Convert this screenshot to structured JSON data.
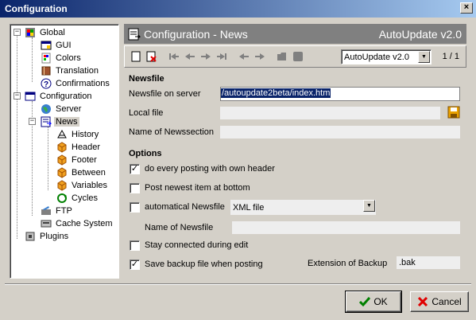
{
  "window": {
    "title": "Configuration",
    "close": "×"
  },
  "tree": {
    "items": [
      {
        "label": "Global"
      },
      {
        "label": "GUI"
      },
      {
        "label": "Colors"
      },
      {
        "label": "Translation"
      },
      {
        "label": "Confirmations"
      },
      {
        "label": "Configuration"
      },
      {
        "label": "Server"
      },
      {
        "label": "News"
      },
      {
        "label": "History"
      },
      {
        "label": "Header"
      },
      {
        "label": "Footer"
      },
      {
        "label": "Between"
      },
      {
        "label": "Variables"
      },
      {
        "label": "Cycles"
      },
      {
        "label": "FTP"
      },
      {
        "label": "Cache System"
      },
      {
        "label": "Plugins"
      }
    ],
    "expander_minus": "−"
  },
  "panel": {
    "title": "Configuration - News",
    "version": "AutoUpdate v2.0"
  },
  "toolbar": {
    "profile_selected": "AutoUpdate v2.0",
    "page_info": "1 / 1"
  },
  "newsfile": {
    "heading": "Newsfile",
    "server_label": "Newsfile on server",
    "server_value": "/autoupdate2beta/index.htm",
    "local_label": "Local file",
    "local_value": "",
    "section_label": "Name of Newssection",
    "section_value": ""
  },
  "options": {
    "heading": "Options",
    "own_header": {
      "label": "do every posting with own header",
      "checked": true
    },
    "newest_bottom": {
      "label": "Post newest item at bottom",
      "checked": false
    },
    "auto_newsfile": {
      "label": "automatical Newsfile",
      "checked": false
    },
    "format_selected": "XML file",
    "newsfile_name_label": "Name of Newsfile",
    "newsfile_name_value": "",
    "stay_connected": {
      "label": "Stay connected during edit",
      "checked": false
    },
    "save_backup": {
      "label": "Save backup file when posting",
      "checked": true
    },
    "backup_ext_label": "Extension of Backup",
    "backup_ext_value": ".bak",
    "check_mark": "✓"
  },
  "buttons": {
    "ok": "OK",
    "cancel": "Cancel"
  },
  "colors": {
    "title_start": "#0a246a",
    "title_end": "#a6caf0",
    "panel_header": "#808080",
    "selection": "#0a246a"
  }
}
